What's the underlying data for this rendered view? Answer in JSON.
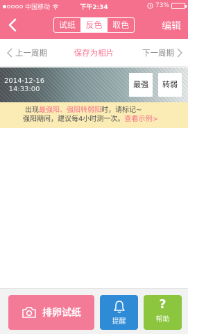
{
  "status_bar": {
    "carrier": "中国移动",
    "time": "下午2:34",
    "battery_pct": "73%",
    "battery_level": 0.73
  },
  "nav": {
    "segments": [
      {
        "label": "试纸",
        "active": false
      },
      {
        "label": "反色",
        "active": true
      },
      {
        "label": "取色",
        "active": false
      }
    ],
    "edit_label": "编辑"
  },
  "period_bar": {
    "prev": "上一周期",
    "save": "保存为相片",
    "next": "下一周期"
  },
  "strip": {
    "date": "2014-12-16",
    "time": "14:33:00",
    "btn_strongest": "最强",
    "btn_weakening": "转弱"
  },
  "hint": {
    "line1_a": "出现",
    "line1_b": "最强阳、强阳转弱阳",
    "line1_c": "时，请标记~",
    "line2_a": "强阳期间，建议每4小时测一次。",
    "line2_link": "查看示例>"
  },
  "toolbar": {
    "main_label": "排卵试纸",
    "remind_label": "提醒",
    "help_label": "帮助",
    "help_glyph": "?"
  },
  "colors": {
    "brand": "#f5708d",
    "remind": "#2f8bd6",
    "help": "#8cc63f",
    "hint_bg": "#fbebb4"
  }
}
